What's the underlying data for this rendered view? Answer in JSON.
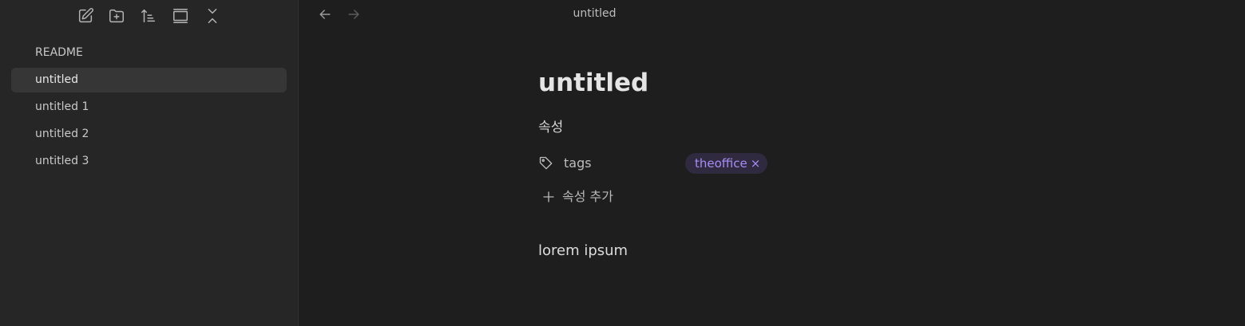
{
  "toolbar": {
    "icons": [
      "new-note-icon",
      "new-folder-icon",
      "sort-icon",
      "auto-reveal-icon",
      "collapse-all-icon"
    ]
  },
  "sidebar": {
    "items": [
      {
        "label": "README"
      },
      {
        "label": "untitled",
        "active": true
      },
      {
        "label": "untitled 1"
      },
      {
        "label": "untitled 2"
      },
      {
        "label": "untitled 3"
      }
    ]
  },
  "header": {
    "tab_title": "untitled",
    "back_icon": "arrow-left-icon",
    "forward_icon": "arrow-right-icon"
  },
  "note": {
    "title": "untitled",
    "properties_heading": "속성",
    "property": {
      "key": "tags",
      "icon": "tag-icon",
      "value": "theoffice",
      "remove_glyph": "×"
    },
    "add_property_label": "속성 추가",
    "body": "lorem ipsum"
  },
  "colors": {
    "sidebar_bg": "#262626",
    "main_bg": "#1e1e1e",
    "active_item_bg": "#363636",
    "tag_text": "#a98cf4",
    "tag_bg": "#2f2a3f"
  }
}
